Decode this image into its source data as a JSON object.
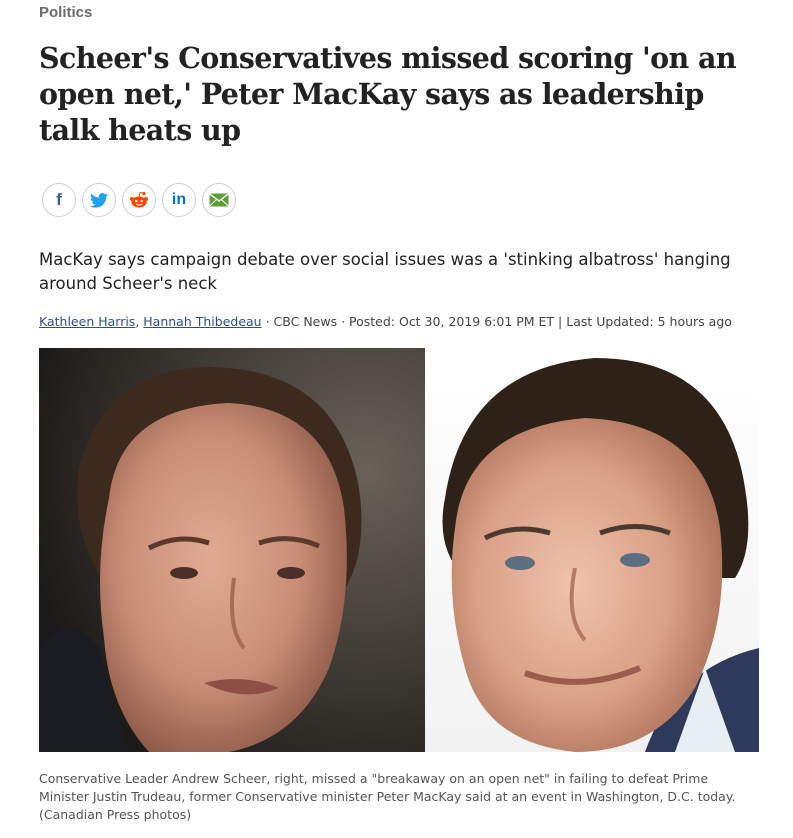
{
  "section": "Politics",
  "headline": "Scheer's Conservatives missed scoring 'on an open net,' Peter MacKay says as leadership talk heats up",
  "share": [
    {
      "name": "share-facebook-button",
      "icon": "facebook-icon",
      "glyph": "f",
      "color": "#3b5998"
    },
    {
      "name": "share-twitter-button",
      "icon": "twitter-icon",
      "glyph": "",
      "color": "#1da1f2"
    },
    {
      "name": "share-reddit-button",
      "icon": "reddit-icon",
      "glyph": "",
      "color": "#ff4500"
    },
    {
      "name": "share-linkedin-button",
      "icon": "linkedin-icon",
      "glyph": "in",
      "color": "#0077b5"
    },
    {
      "name": "share-email-button",
      "icon": "email-icon",
      "glyph": "",
      "color": "#5a9e3a"
    }
  ],
  "deck": "MacKay says campaign debate over social issues was a 'stinking albatross' hanging around Scheer's neck",
  "byline": {
    "author1": "Kathleen Harris",
    "separator": ", ",
    "author2": "Hannah Thibedeau",
    "meta": " · CBC News · Posted: Oct 30, 2019 6:01 PM ET | Last Updated: 5 hours ago"
  },
  "caption": "Conservative Leader Andrew Scheer, right, missed a \"breakaway on an open net\" in failing to defeat Prime Minister Justin Trudeau, former Conservative minister Peter MacKay said at an event in Washington, D.C. today. (Canadian Press photos)"
}
